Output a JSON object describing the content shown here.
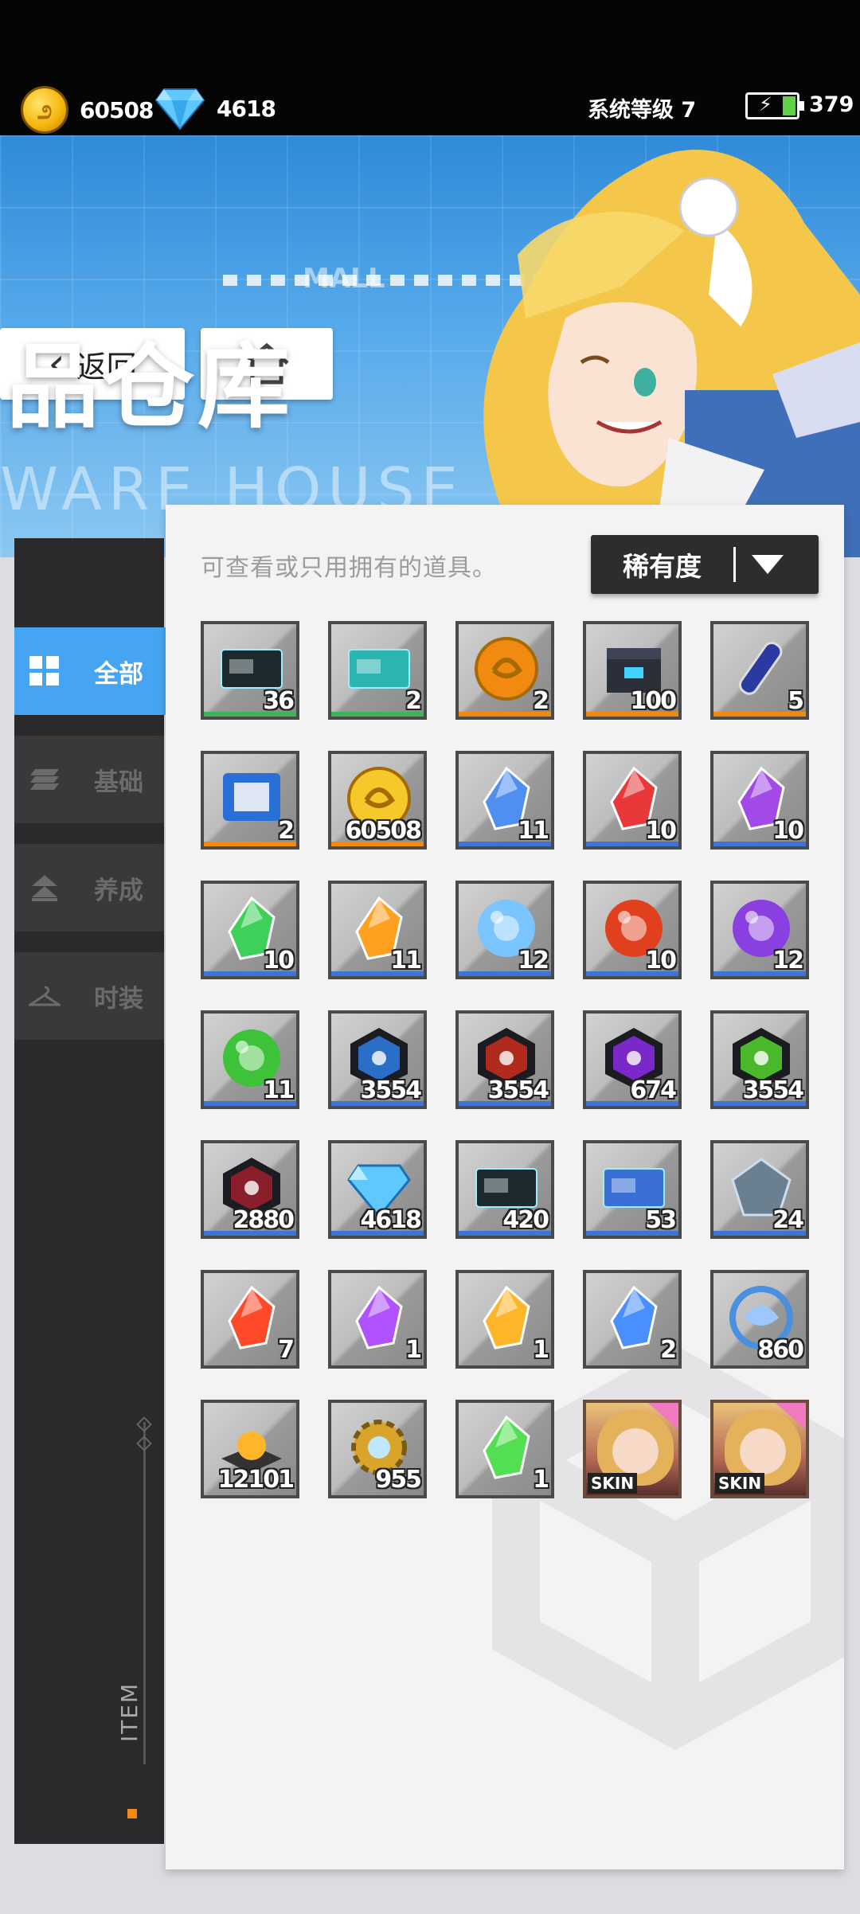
{
  "topbar": {
    "coins": "60508",
    "gems": "4618",
    "system_level": "系统等级 7",
    "energy": "379"
  },
  "banner": {
    "back_label": "返回",
    "title": "品仓库",
    "subtitle": "WARE HOUSE",
    "sign_text": "MALL"
  },
  "sidebar": {
    "items": [
      {
        "label": "全部",
        "icon": "grid-icon",
        "active": true
      },
      {
        "label": "基础",
        "icon": "stack-icon",
        "active": false
      },
      {
        "label": "养成",
        "icon": "upgrade-icon",
        "active": false
      },
      {
        "label": "时装",
        "icon": "hanger-icon",
        "active": false
      }
    ],
    "footer_tag": "ITEM"
  },
  "panel": {
    "hint": "可查看或只用拥有的道具。",
    "sort_label": "稀有度"
  },
  "colors": {
    "accent": "#45a5f3",
    "rarity_green": "#3fb45a",
    "rarity_orange": "#f08a10",
    "rarity_blue": "#3e74d6",
    "rarity_purple": "#8a3fd0"
  },
  "items": [
    {
      "name": "b1-ticket",
      "count": "36",
      "rarity": "green",
      "art": "ticket-dark"
    },
    {
      "name": "pass-card",
      "count": "2",
      "rarity": "green",
      "art": "ticket-teal"
    },
    {
      "name": "gold-orb",
      "count": "2",
      "rarity": "orange",
      "art": "orb-gold"
    },
    {
      "name": "supply-box",
      "count": "100",
      "rarity": "orange",
      "art": "box"
    },
    {
      "name": "serum-vial",
      "count": "5",
      "rarity": "orange",
      "art": "vial"
    },
    {
      "name": "data-chip",
      "count": "2",
      "rarity": "orange",
      "art": "chip"
    },
    {
      "name": "gold-coin",
      "count": "60508",
      "rarity": "orange",
      "art": "coin"
    },
    {
      "name": "blue-crystal",
      "count": "11",
      "rarity": "blue",
      "art": "crystal-blue"
    },
    {
      "name": "red-crystal",
      "count": "10",
      "rarity": "blue",
      "art": "crystal-red"
    },
    {
      "name": "purple-crystal",
      "count": "10",
      "rarity": "blue",
      "art": "crystal-purple"
    },
    {
      "name": "green-crystal",
      "count": "10",
      "rarity": "blue",
      "art": "crystal-green"
    },
    {
      "name": "orange-crystal",
      "count": "11",
      "rarity": "blue",
      "art": "crystal-orange"
    },
    {
      "name": "blue-core",
      "count": "12",
      "rarity": "blue",
      "art": "core-blue"
    },
    {
      "name": "red-core",
      "count": "10",
      "rarity": "blue",
      "art": "core-red"
    },
    {
      "name": "purple-core",
      "count": "12",
      "rarity": "blue",
      "art": "core-purple"
    },
    {
      "name": "green-core",
      "count": "11",
      "rarity": "blue",
      "art": "core-green"
    },
    {
      "name": "ice-hex",
      "count": "3554",
      "rarity": "blue",
      "art": "hex-blue"
    },
    {
      "name": "fire-hex",
      "count": "3554",
      "rarity": "blue",
      "art": "hex-red"
    },
    {
      "name": "void-hex",
      "count": "674",
      "rarity": "blue",
      "art": "hex-purple"
    },
    {
      "name": "bio-hex",
      "count": "3554",
      "rarity": "blue",
      "art": "hex-green"
    },
    {
      "name": "crimson-hex",
      "count": "2880",
      "rarity": "blue",
      "art": "hex-crimson"
    },
    {
      "name": "diamond",
      "count": "4618",
      "rarity": "blue",
      "art": "diamond"
    },
    {
      "name": "game-card",
      "count": "420",
      "rarity": "blue",
      "art": "card"
    },
    {
      "name": "flag-ticket",
      "count": "53",
      "rarity": "blue",
      "art": "flag"
    },
    {
      "name": "steel-badge",
      "count": "24",
      "rarity": "blue",
      "art": "badge"
    },
    {
      "name": "red-gem",
      "count": "7",
      "rarity": "none",
      "art": "gem-red"
    },
    {
      "name": "purple-gem",
      "count": "1",
      "rarity": "none",
      "art": "gem-purple"
    },
    {
      "name": "gold-gem",
      "count": "1",
      "rarity": "none",
      "art": "gem-gold"
    },
    {
      "name": "blue-gem",
      "count": "2",
      "rarity": "none",
      "art": "gem-blue"
    },
    {
      "name": "swirl-orb",
      "count": "860",
      "rarity": "none",
      "art": "swirl"
    },
    {
      "name": "energy-pad",
      "count": "12101",
      "rarity": "none",
      "art": "pad"
    },
    {
      "name": "gear",
      "count": "955",
      "rarity": "none",
      "art": "gear"
    },
    {
      "name": "green-gem",
      "count": "1",
      "rarity": "none",
      "art": "gem-green"
    },
    {
      "name": "skin-1",
      "count": "",
      "rarity": "skin",
      "art": "skin",
      "tag": "SKIN"
    },
    {
      "name": "skin-2",
      "count": "",
      "rarity": "skin",
      "art": "skin",
      "tag": "SKIN"
    }
  ]
}
